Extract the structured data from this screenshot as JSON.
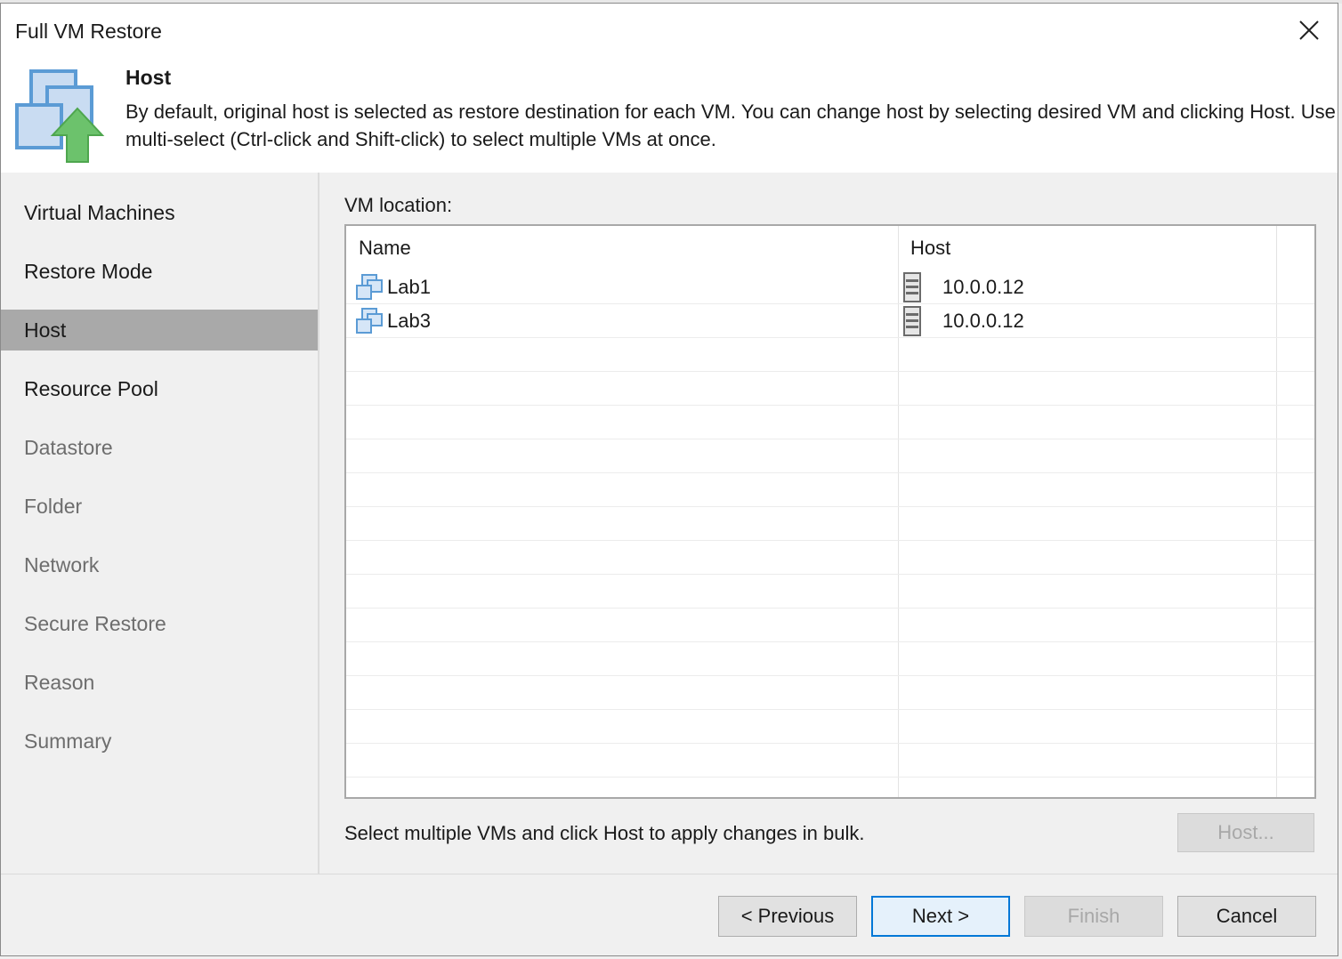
{
  "window": {
    "title": "Full VM Restore"
  },
  "header": {
    "title": "Host",
    "description": "By default, original host is selected as restore destination for each VM. You can change host by selecting desired VM and clicking Host. Use multi-select (Ctrl-click and Shift-click) to select multiple VMs at once."
  },
  "sidebar": {
    "items": [
      {
        "label": "Virtual Machines",
        "state": "enabled"
      },
      {
        "label": "Restore Mode",
        "state": "enabled"
      },
      {
        "label": "Host",
        "state": "active"
      },
      {
        "label": "Resource Pool",
        "state": "enabled"
      },
      {
        "label": "Datastore",
        "state": "disabled"
      },
      {
        "label": "Folder",
        "state": "disabled"
      },
      {
        "label": "Network",
        "state": "disabled"
      },
      {
        "label": "Secure Restore",
        "state": "disabled"
      },
      {
        "label": "Reason",
        "state": "disabled"
      },
      {
        "label": "Summary",
        "state": "disabled"
      }
    ]
  },
  "main": {
    "section_label": "VM location:",
    "columns": [
      "Name",
      "Host"
    ],
    "rows": [
      {
        "name": "Lab1",
        "host": "10.0.0.12"
      },
      {
        "name": "Lab3",
        "host": "10.0.0.12"
      }
    ],
    "hint": "Select multiple VMs and click Host to apply changes in bulk.",
    "host_button": "Host..."
  },
  "footer": {
    "previous": "< Previous",
    "next": "Next >",
    "finish": "Finish",
    "cancel": "Cancel"
  },
  "colors": {
    "active_nav": "#a9a9a9",
    "primary_border": "#0078d7",
    "arrow_green": "#5cb85c",
    "monitor_blue": "#5b9bd5"
  }
}
